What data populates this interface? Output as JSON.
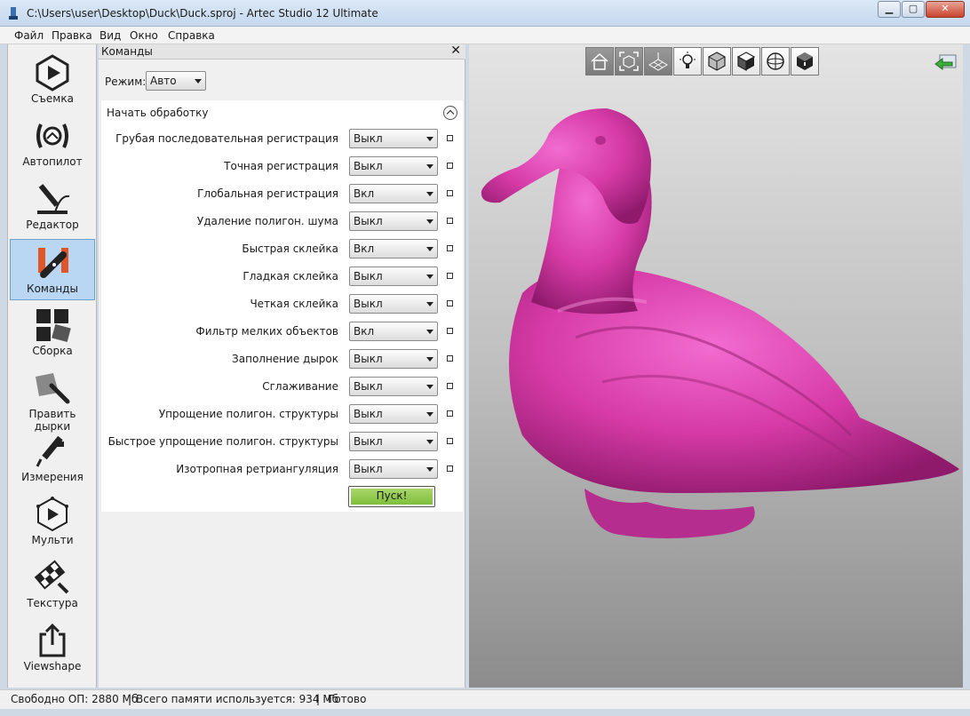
{
  "window": {
    "title": "C:\\Users\\user\\Desktop\\Duck\\Duck.sproj - Artec Studio 12 Ultimate",
    "minimize_glyph": "▁",
    "maximize_glyph": "▢",
    "close_glyph": "✕"
  },
  "menu": [
    "Файл",
    "Правка",
    "Вид",
    "Окно",
    "Справка"
  ],
  "sidebar": {
    "items": [
      {
        "label": "Съемка",
        "icon": "capture-icon"
      },
      {
        "label": "Автопилот",
        "icon": "autopilot-icon"
      },
      {
        "label": "Редактор",
        "icon": "editor-icon"
      },
      {
        "label": "Команды",
        "icon": "commands-icon",
        "active": true
      },
      {
        "label": "Сборка",
        "icon": "assembly-icon"
      },
      {
        "label": "Править дырки",
        "icon": "fix-holes-icon"
      },
      {
        "label": "Измерения",
        "icon": "measures-icon"
      },
      {
        "label": "Мульти",
        "icon": "multi-icon"
      },
      {
        "label": "Текстура",
        "icon": "texture-icon"
      },
      {
        "label": "Viewshape",
        "icon": "viewshape-icon"
      }
    ]
  },
  "panel": {
    "title": "Команды",
    "close_glyph": "✕",
    "mode_label": "Режим:",
    "mode_value": "Авто",
    "section_title": "Начать обработку",
    "commands": [
      {
        "label": "Грубая последовательная регистрация",
        "value": "Выкл"
      },
      {
        "label": "Точная регистрация",
        "value": "Выкл"
      },
      {
        "label": "Глобальная регистрация",
        "value": "Вкл"
      },
      {
        "label": "Удаление полигон. шума",
        "value": "Выкл"
      },
      {
        "label": "Быстрая склейка",
        "value": "Вкл"
      },
      {
        "label": "Гладкая склейка",
        "value": "Выкл"
      },
      {
        "label": "Четкая склейка",
        "value": "Выкл"
      },
      {
        "label": "Фильтр мелких объектов",
        "value": "Вкл"
      },
      {
        "label": "Заполнение дырок",
        "value": "Выкл"
      },
      {
        "label": "Сглаживание",
        "value": "Выкл"
      },
      {
        "label": "Упрощение полигон. структуры",
        "value": "Выкл"
      },
      {
        "label": "Быстрое упрощение полигон. структуры",
        "value": "Выкл"
      },
      {
        "label": "Изотропная ретриангуляция",
        "value": "Выкл"
      }
    ],
    "run_label": "Пуск!"
  },
  "viewport": {
    "toolbar": [
      "home-icon",
      "fit-view-icon",
      "grid-icon",
      "light-icon",
      "texture-mode-icon",
      "solid-mode-icon",
      "sphere-mode-icon",
      "cube-mode-icon"
    ],
    "model_color": "#d63aa6",
    "back_icon": "return-arrow-icon"
  },
  "status": {
    "free_ram": "Свободно ОП: 2880 Мб",
    "used_memory": "Всего памяти используется: 934 Мб",
    "state": "Готово",
    "separator": "|"
  }
}
